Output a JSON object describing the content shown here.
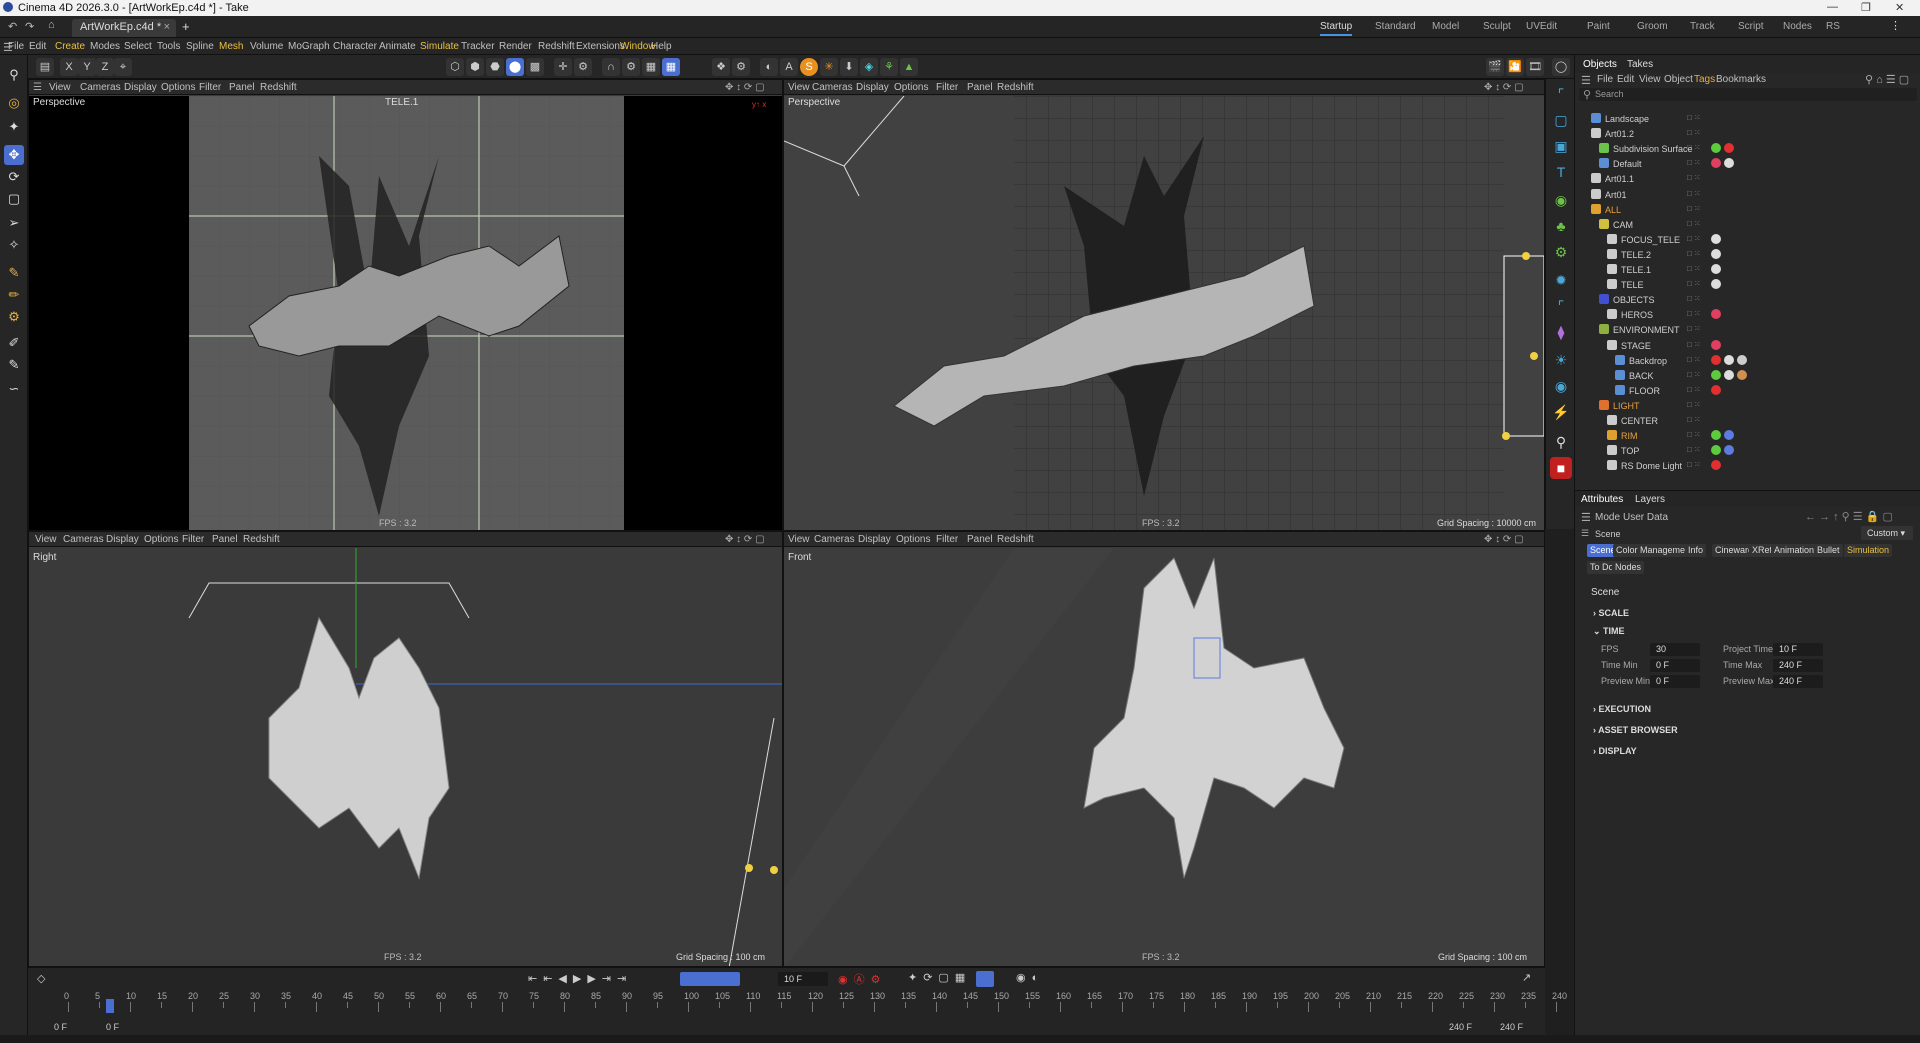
{
  "window": {
    "title": "Cinema 4D 2026.3.0 - [ArtWorkEp.c4d *] - Take"
  },
  "tabs": {
    "file": "ArtWorkEp.c4d *",
    "plus": "+"
  },
  "layouts": [
    "Startup",
    "Standard",
    "Model",
    "Sculpt",
    "UVEdit",
    "Paint",
    "Groom",
    "Track",
    "Script",
    "Nodes",
    "RS"
  ],
  "menu": [
    "File",
    "Edit",
    "Create",
    "Modes",
    "Select",
    "Tools",
    "Spline",
    "Mesh",
    "Volume",
    "MoGraph",
    "Character",
    "Animate",
    "Simulate",
    "Tracker",
    "Render",
    "Redshift",
    "Extensions",
    "Window",
    "Help"
  ],
  "viewport_menu": [
    "View",
    "Cameras",
    "Display",
    "Options",
    "Filter",
    "Panel",
    "Redshift"
  ],
  "viewports": [
    {
      "label": "Perspective",
      "camera": "TELE.1",
      "fps": "FPS : 3.2",
      "grid": ""
    },
    {
      "label": "Perspective",
      "camera": "",
      "fps": "FPS : 3.2",
      "grid": "Grid Spacing : 10000 cm"
    },
    {
      "label": "Right",
      "camera": "",
      "fps": "FPS : 3.2",
      "grid": "Grid Spacing : 100 cm"
    },
    {
      "label": "Front",
      "camera": "",
      "fps": "FPS : 3.2",
      "grid": "Grid Spacing : 100 cm"
    }
  ],
  "objects_panel": {
    "tabs": [
      "Objects",
      "Takes"
    ],
    "menu": [
      "File",
      "Edit",
      "View",
      "Object",
      "Tags",
      "Bookmarks"
    ],
    "search_placeholder": "Search",
    "items": [
      {
        "name": "Landscape",
        "indent": 0,
        "icon": "landscape-icon",
        "color": "#5a8fd6"
      },
      {
        "name": "Art01.2",
        "indent": 0,
        "icon": "null-icon",
        "color": "#cccccc"
      },
      {
        "name": "Subdivision Surface",
        "indent": 1,
        "icon": "subdivision-icon",
        "color": "#6cc24a"
      },
      {
        "name": "Default",
        "indent": 1,
        "icon": "cone-icon",
        "color": "#5a8fd6"
      },
      {
        "name": "Art01.1",
        "indent": 0,
        "icon": "null-icon",
        "color": "#cccccc"
      },
      {
        "name": "Art01",
        "indent": 0,
        "icon": "null-icon",
        "color": "#cccccc"
      },
      {
        "name": "ALL",
        "indent": 0,
        "icon": "null-icon",
        "color": "#e0a030"
      },
      {
        "name": "CAM",
        "indent": 1,
        "icon": "null-icon",
        "color": "#d0c040"
      },
      {
        "name": "FOCUS_TELE",
        "indent": 2,
        "icon": "camera-icon",
        "color": "#cccccc"
      },
      {
        "name": "TELE.2",
        "indent": 2,
        "icon": "camera-icon",
        "color": "#cccccc"
      },
      {
        "name": "TELE.1",
        "indent": 2,
        "icon": "camera-icon",
        "color": "#cccccc"
      },
      {
        "name": "TELE",
        "indent": 2,
        "icon": "camera-icon",
        "color": "#cccccc"
      },
      {
        "name": "OBJECTS",
        "indent": 1,
        "icon": "null-icon",
        "color": "#4050d0"
      },
      {
        "name": "HEROS",
        "indent": 2,
        "icon": "null-icon",
        "color": "#cccccc"
      },
      {
        "name": "ENVIRONMENT",
        "indent": 1,
        "icon": "null-icon",
        "color": "#8fb040"
      },
      {
        "name": "STAGE",
        "indent": 2,
        "icon": "stage-icon",
        "color": "#cccccc"
      },
      {
        "name": "Backdrop",
        "indent": 3,
        "icon": "backdrop-icon",
        "color": "#5a8fd6"
      },
      {
        "name": "BACK",
        "indent": 3,
        "icon": "plane-icon",
        "color": "#5a8fd6"
      },
      {
        "name": "FLOOR",
        "indent": 3,
        "icon": "plane-icon",
        "color": "#5a8fd6"
      },
      {
        "name": "LIGHT",
        "indent": 1,
        "icon": "null-icon",
        "color": "#e07030"
      },
      {
        "name": "CENTER",
        "indent": 2,
        "icon": "light-icon",
        "color": "#cccccc"
      },
      {
        "name": "RIM",
        "indent": 2,
        "icon": "light-icon",
        "color": "#e0a030"
      },
      {
        "name": "TOP",
        "indent": 2,
        "icon": "light-icon",
        "color": "#cccccc"
      },
      {
        "name": "RS Dome Light",
        "indent": 2,
        "icon": "dome-light-icon",
        "color": "#cccccc"
      }
    ]
  },
  "attributes_panel": {
    "tabs": [
      "Attributes",
      "Layers"
    ],
    "menu": [
      "Mode",
      "User Data"
    ],
    "path": "Scene",
    "preset": "Custom",
    "subtabs": [
      "Scene",
      "Color Management",
      "Info",
      "Cineware",
      "XRefs",
      "Animation",
      "Bullet",
      "Simulation",
      "To Do",
      "Nodes"
    ],
    "heading": "Scene",
    "sections": [
      "SCALE",
      "TIME",
      "EXECUTION",
      "ASSET BROWSER",
      "DISPLAY"
    ],
    "time_fields": [
      {
        "label": "FPS",
        "value": "30"
      },
      {
        "label": "Project Time",
        "value": "10 F"
      },
      {
        "label": "Time Min",
        "value": "0 F"
      },
      {
        "label": "Time Max",
        "value": "240 F"
      },
      {
        "label": "Preview Min",
        "value": "0 F"
      },
      {
        "label": "Preview Max",
        "value": "240 F"
      }
    ]
  },
  "timeline": {
    "current_frame": "10 F",
    "ticks": [
      "0",
      "5",
      "10",
      "15",
      "20",
      "25",
      "30",
      "35",
      "40",
      "45",
      "50",
      "55",
      "60",
      "65",
      "70",
      "75",
      "80",
      "85",
      "90",
      "95",
      "100",
      "105",
      "110",
      "115",
      "120",
      "125",
      "130",
      "135",
      "140",
      "145",
      "150",
      "155",
      "160",
      "165",
      "170",
      "175",
      "180",
      "185",
      "190",
      "195",
      "200",
      "205",
      "210",
      "215",
      "220",
      "225",
      "230",
      "235",
      "240"
    ],
    "range_start": "0 F",
    "preview_start": "0 F",
    "range_end": "240 F",
    "preview_end": "240 F"
  }
}
